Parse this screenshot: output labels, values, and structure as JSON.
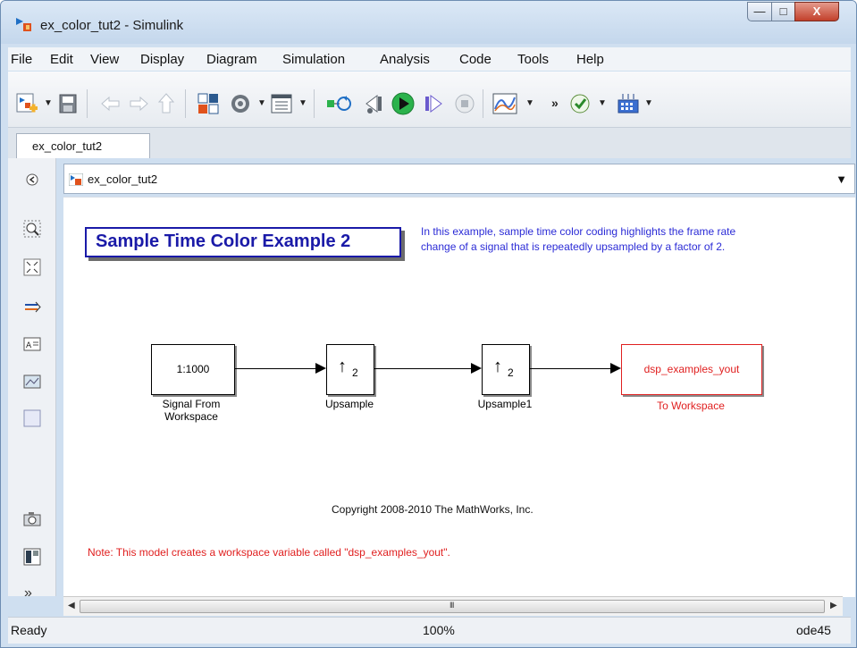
{
  "window": {
    "title": "ex_color_tut2 - Simulink"
  },
  "menu": [
    "File",
    "Edit",
    "View",
    "Display",
    "Diagram",
    "Simulation",
    "Analysis",
    "Code",
    "Tools",
    "Help"
  ],
  "tab": {
    "label": "ex_color_tut2"
  },
  "address": {
    "text": "ex_color_tut2"
  },
  "model": {
    "title": "Sample Time Color Example 2",
    "description_line1": "In this example, sample time color coding highlights the frame rate",
    "description_line2": "change of a signal that is repeatedly upsampled by a factor of 2.",
    "blocks": {
      "source": {
        "value": "1:1000",
        "label_line1": "Signal From",
        "label_line2": "Workspace"
      },
      "upsample": {
        "symbol": "↑",
        "factor": "2",
        "label": "Upsample"
      },
      "upsample1": {
        "symbol": "↑",
        "factor": "2",
        "label": "Upsample1"
      },
      "sink": {
        "value": "dsp_examples_yout",
        "label": "To Workspace"
      }
    },
    "copyright": "Copyright 2008-2010 The MathWorks, Inc.",
    "note": "Note: This model creates a workspace variable called \"dsp_examples_yout\"."
  },
  "scrollbar": {
    "grip": "III"
  },
  "status": {
    "left": "Ready",
    "zoom": "100%",
    "solver": "ode45"
  },
  "colors": {
    "title_blue": "#1a1aa8",
    "desc_blue": "#2b2bd6",
    "sink_red": "#e02020",
    "run_green": "#2bb24c"
  }
}
